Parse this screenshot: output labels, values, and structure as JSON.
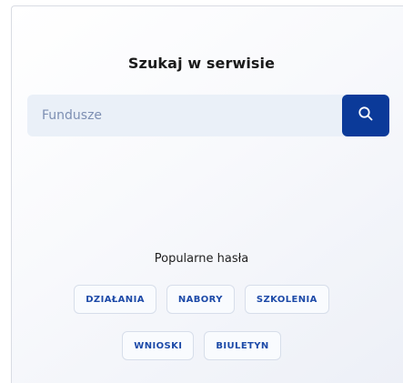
{
  "search": {
    "title": "Szukaj w serwisie",
    "placeholder": "Fundusze",
    "button_icon": "search-icon"
  },
  "popular": {
    "label": "Popularne hasła",
    "tags": [
      "DZIAŁANIA",
      "NABORY",
      "SZKOLENIA",
      "WNIOSKI",
      "BIULETYN"
    ]
  },
  "colors": {
    "accent": "#0b3a99",
    "tag_text": "#1d4aa8",
    "input_bg": "#eaf0f8"
  }
}
